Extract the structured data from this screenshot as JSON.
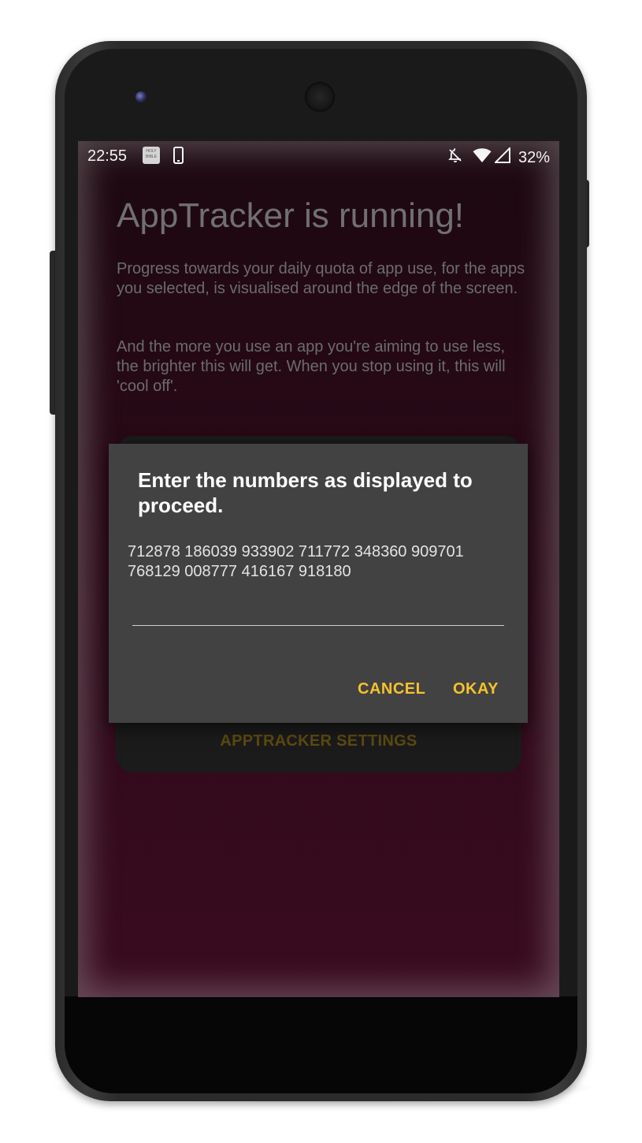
{
  "status_bar": {
    "time": "22:55",
    "bible_icon_text": "HOLY BIBLE",
    "battery": "32%",
    "icons": [
      "bible-app-icon",
      "phone-icon",
      "do-not-disturb-bell-icon",
      "wifi-icon",
      "signal-icon"
    ]
  },
  "app": {
    "title": "AppTracker is running!",
    "paragraph_1": "Progress towards your daily quota of app use, for the apps you selected, is visualised around the edge of the screen.",
    "paragraph_2": "And the more you use an app you're aiming to use less, the brighter this will get. When you stop using it, this will 'cool off'.",
    "settings_button": "APPTRACKER SETTINGS"
  },
  "dialog": {
    "title": "Enter the numbers as displayed to proceed.",
    "numbers": "712878 186039 933902 711772 348360 909701 768129 008777 416167 918180",
    "input_value": "",
    "cancel_label": "CANCEL",
    "okay_label": "OKAY"
  },
  "colors": {
    "accent": "#f6c22b",
    "dialog_bg": "#424242",
    "screen_bg": "#2b0a18"
  }
}
